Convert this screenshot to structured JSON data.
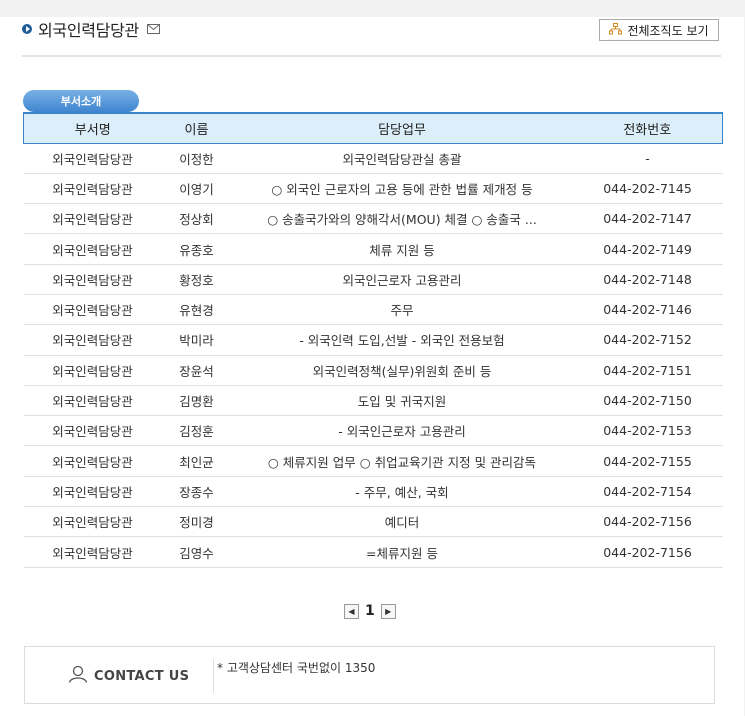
{
  "header": {
    "title": "외국인력담당관",
    "org_button_label": "전체조직도 보기",
    "icons": {
      "bullet": "circle-arrow-icon",
      "mail": "mail-icon",
      "org": "org-chart-icon"
    }
  },
  "section": {
    "tab_label": "부서소개"
  },
  "table": {
    "headers": [
      "부서명",
      "이름",
      "담당업무",
      "전화번호"
    ],
    "rows": [
      [
        "외국인력담당관",
        "이정한",
        "외국인력담당관실 총괄",
        "-"
      ],
      [
        "외국인력담당관",
        "이영기",
        "○ 외국인 근로자의 고용 등에 관한 법률 제개정 등",
        "044-202-7145"
      ],
      [
        "외국인력담당관",
        "정상회",
        "○ 송출국가와의 양해각서(MOU) 체결 ○ 송출국 ...",
        "044-202-7147"
      ],
      [
        "외국인력담당관",
        "유종호",
        "체류 지원 등",
        "044-202-7149"
      ],
      [
        "외국인력담당관",
        "황정호",
        "외국인근로자 고용관리",
        "044-202-7148"
      ],
      [
        "외국인력담당관",
        "유현경",
        "주무",
        "044-202-7146"
      ],
      [
        "외국인력담당관",
        "박미라",
        "- 외국인력 도입,선발 - 외국인 전용보험",
        "044-202-7152"
      ],
      [
        "외국인력담당관",
        "장윤석",
        "외국인력정책(실무)위원회 준비 등",
        "044-202-7151"
      ],
      [
        "외국인력담당관",
        "김명환",
        "도입 및 귀국지원",
        "044-202-7150"
      ],
      [
        "외국인력담당관",
        "김정훈",
        "- 외국인근로자 고용관리",
        "044-202-7153"
      ],
      [
        "외국인력담당관",
        "최인균",
        "○ 체류지원 업무 ○ 취업교육기관 지정 및 관리감독",
        "044-202-7155"
      ],
      [
        "외국인력담당관",
        "장종수",
        "- 주무, 예산, 국회",
        "044-202-7154"
      ],
      [
        "외국인력담당관",
        "정미경",
        "예디터",
        "044-202-7156"
      ],
      [
        "외국인력담당관",
        "김영수",
        "=체류지원 등",
        "044-202-7156"
      ]
    ]
  },
  "pagination": {
    "prev": "◀",
    "current": "1",
    "next": "▶"
  },
  "contact": {
    "label": "CONTACT US",
    "text": "* 고객상담센터 국번없이 1350",
    "icon": "person-icon"
  },
  "colors": {
    "accent": "#3a86c8",
    "header_bg": "#dbeef9",
    "tab_bg": "#4a8fd6"
  }
}
